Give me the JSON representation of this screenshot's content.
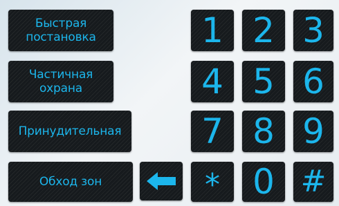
{
  "function_buttons": [
    {
      "line1": "Быстрая",
      "line2": "постановка"
    },
    {
      "line1": "Частичная",
      "line2": "охрана"
    },
    {
      "line1": "Принудительная",
      "line2": ""
    },
    {
      "line1": "Обход зон",
      "line2": ""
    }
  ],
  "keypad": {
    "k1": "1",
    "k2": "2",
    "k3": "3",
    "k4": "4",
    "k5": "5",
    "k6": "6",
    "k7": "7",
    "k8": "8",
    "k9": "9",
    "kstar": "*",
    "k0": "0",
    "khash": "#"
  },
  "backspace": {
    "icon": "arrow-left-icon"
  },
  "colors": {
    "accent": "#1cb6ec",
    "button_bg": "#161a1d"
  }
}
